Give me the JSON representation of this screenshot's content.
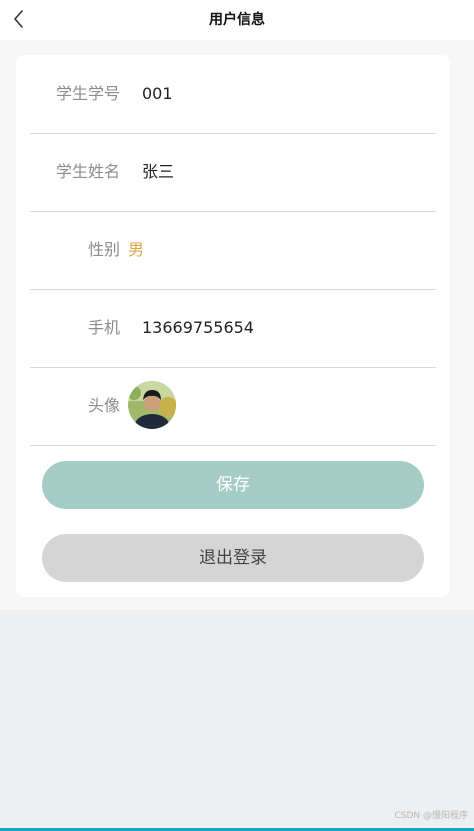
{
  "header": {
    "title": "用户信息",
    "back_icon": "chevron-left-icon"
  },
  "form": {
    "student_id": {
      "label": "学生学号",
      "value": "001"
    },
    "student_name": {
      "label": "学生姓名",
      "value": "张三"
    },
    "gender": {
      "label": "性别",
      "value": "男"
    },
    "phone": {
      "label": "手机",
      "value": "13669755654"
    },
    "avatar": {
      "label": "头像"
    }
  },
  "buttons": {
    "save": "保存",
    "logout": "退出登录"
  },
  "watermark": "CSDN @慢阳程序",
  "colors": {
    "save_button": "#a5cdc5",
    "logout_button": "#d5d5d5",
    "gender_value": "#e3a34a",
    "accent_bottom": "#1aa3c8"
  }
}
